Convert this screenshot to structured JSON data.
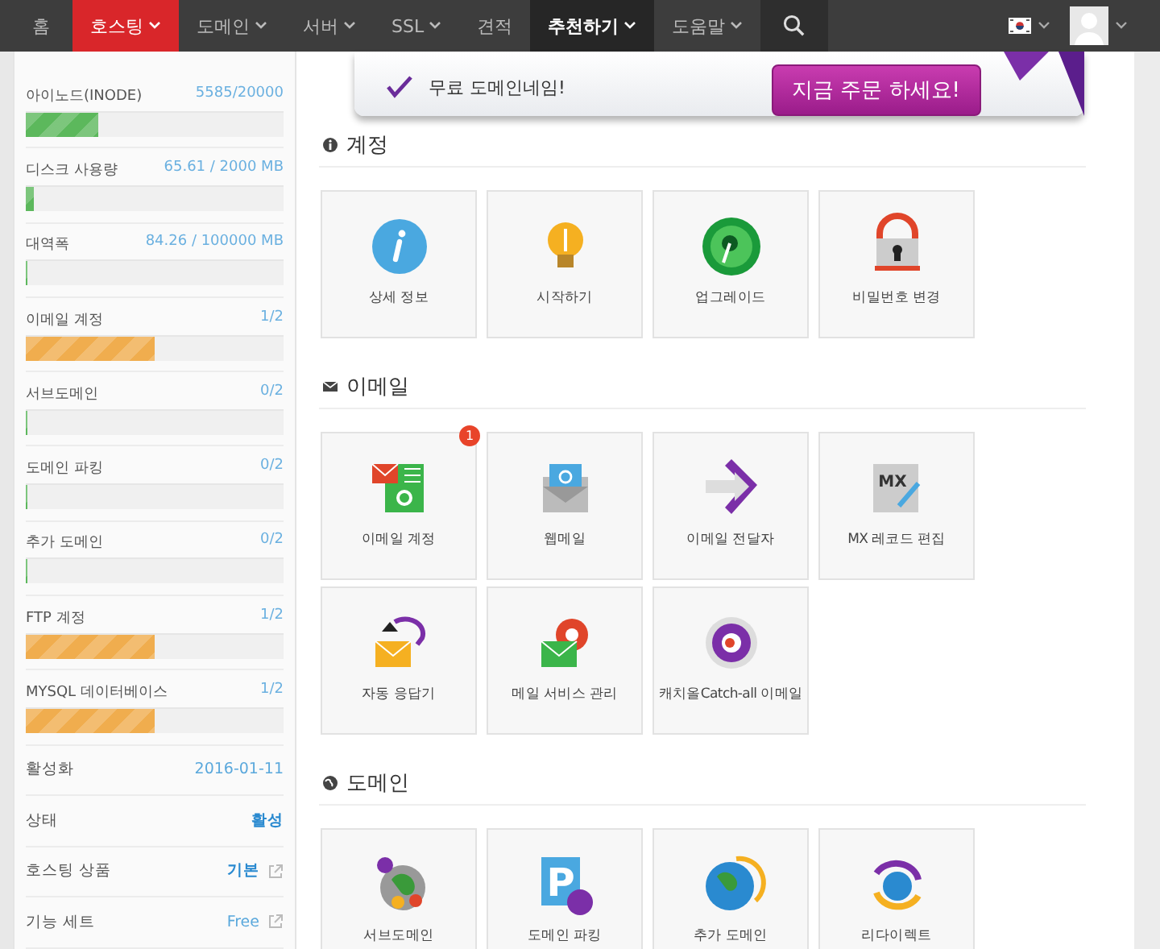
{
  "nav": {
    "items": [
      {
        "label": "홈",
        "selected": false,
        "caret": false,
        "highlighted": false
      },
      {
        "label": "호스팅",
        "selected": true,
        "caret": true,
        "highlighted": false
      },
      {
        "label": "도메인",
        "selected": false,
        "caret": true,
        "highlighted": false
      },
      {
        "label": "서버",
        "selected": false,
        "caret": true,
        "highlighted": false
      },
      {
        "label": "SSL",
        "selected": false,
        "caret": true,
        "highlighted": false
      },
      {
        "label": "견적",
        "selected": false,
        "caret": false,
        "highlighted": false
      },
      {
        "label": "추천하기",
        "selected": false,
        "caret": true,
        "highlighted": true
      },
      {
        "label": "도움말",
        "selected": false,
        "caret": true,
        "highlighted": false
      }
    ]
  },
  "sidebar": {
    "usage": [
      {
        "label": "아이노드(INODE)",
        "value": "5585/20000",
        "level": 0.28,
        "color": "#5cb85c"
      },
      {
        "label": "디스크 사용량",
        "value": "65.61 / 2000 MB",
        "level": 0.033,
        "color": "#5cb85c"
      },
      {
        "label": "대역폭",
        "value": "84.26 / 100000 MB",
        "level": 0.0
      },
      {
        "label": "이메일 계정",
        "value": "1/2",
        "level": 0.5,
        "color": "#f0ad4e"
      },
      {
        "label": "서브도메인",
        "value": "0/2",
        "level": 0.0
      },
      {
        "label": "도메인 파킹",
        "value": "0/2",
        "level": 0.0
      },
      {
        "label": "추가 도메인",
        "value": "0/2",
        "level": 0.0
      },
      {
        "label": "FTP 계정",
        "value": "1/2",
        "level": 0.5,
        "color": "#f0ad4e"
      },
      {
        "label": "MYSQL 데이터베이스",
        "value": "1/2",
        "level": 0.5,
        "color": "#f0ad4e"
      }
    ],
    "info": [
      {
        "label": "활성화",
        "value": "2016-01-11",
        "bold": false,
        "link": false
      },
      {
        "label": "상태",
        "value": "활성",
        "bold": true,
        "link": false
      },
      {
        "label": "호스팅 상품",
        "value": "기본",
        "bold": true,
        "link": true
      },
      {
        "label": "기능 세트",
        "value": "Free",
        "bold": false,
        "link": true
      }
    ]
  },
  "banner": {
    "feature": "무료 도메인네임!",
    "button": "지금 주문 하세요!"
  },
  "sections": [
    {
      "title": "계정",
      "tiles": [
        {
          "label": "상세 정보"
        },
        {
          "label": "시작하기"
        },
        {
          "label": "업그레이드"
        },
        {
          "label": "비밀번호 변경"
        }
      ]
    },
    {
      "title": "이메일",
      "tiles": [
        {
          "label": "이메일 계정",
          "badge": "1"
        },
        {
          "label": "웹메일"
        },
        {
          "label": "이메일 전달자"
        },
        {
          "label": "MX 레코드 편집",
          "icon_text": "MX"
        },
        {
          "label": "자동 응답기"
        },
        {
          "label": "메일 서비스 관리"
        },
        {
          "label": "캐치올Catch-all 이메일"
        }
      ]
    },
    {
      "title": "도메인",
      "tiles": [
        {
          "label": "서브도메인"
        },
        {
          "label": "도메인 파킹",
          "icon_text": "P"
        },
        {
          "label": "추가 도메인"
        },
        {
          "label": "리다이렉트"
        }
      ]
    }
  ]
}
